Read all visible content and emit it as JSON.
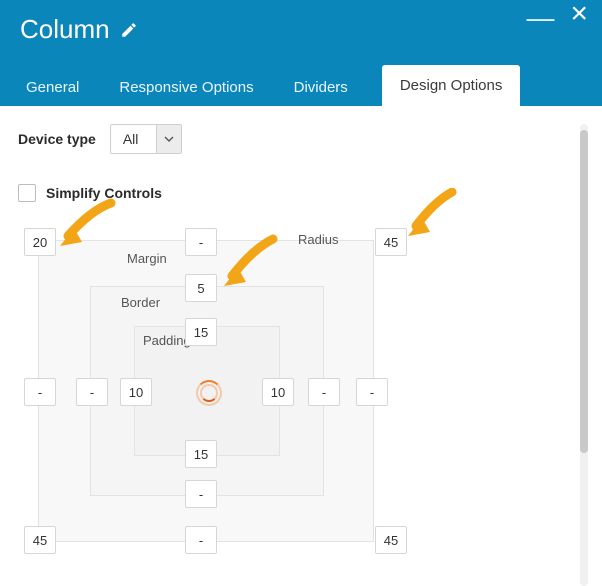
{
  "header": {
    "title": "Column",
    "minimize_glyph": "—",
    "close_glyph": "×"
  },
  "tabs": {
    "general": "General",
    "responsive": "Responsive Options",
    "dividers": "Dividers",
    "design": "Design Options",
    "active": "design"
  },
  "device": {
    "label": "Device type",
    "value": "All"
  },
  "simplify": {
    "label": "Simplify Controls",
    "checked": false
  },
  "boxmodel": {
    "labels": {
      "margin": "Margin",
      "border": "Border",
      "padding": "Padding",
      "radius": "Radius"
    },
    "margin": {
      "top": "-",
      "right": "-",
      "bottom": "-",
      "left": "-"
    },
    "border": {
      "top": "5",
      "right": "-",
      "bottom": "-",
      "left": "-"
    },
    "padding": {
      "top": "15",
      "right": "10",
      "bottom": "15",
      "left": "10"
    },
    "radius": {
      "tl": "20",
      "tr": "45",
      "bl": "45",
      "br": "45"
    }
  }
}
